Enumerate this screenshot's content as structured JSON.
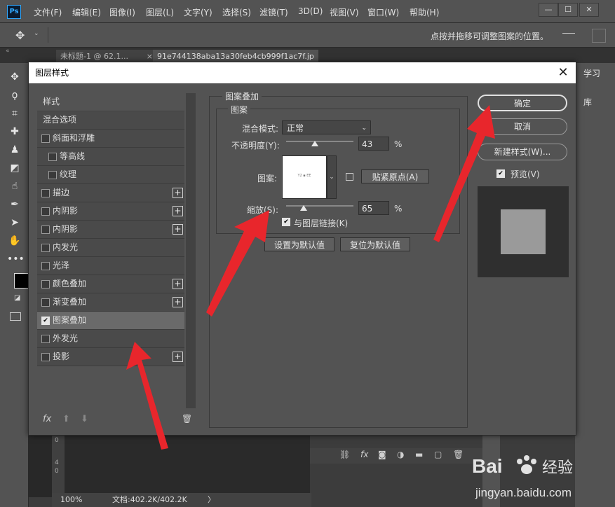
{
  "app": {
    "logo": "Ps",
    "menu": [
      "文件(F)",
      "编辑(E)",
      "图像(I)",
      "图层(L)",
      "文字(Y)",
      "选择(S)",
      "滤镜(T)",
      "3D(D)",
      "视图(V)",
      "窗口(W)",
      "帮助(H)"
    ],
    "window_buttons": [
      "—",
      "☐",
      "✕"
    ],
    "options_hint": "点按并拖移可调整图案的位置。",
    "tabs": [
      "未标题-1 @ 62.1...",
      "91e744138aba13a30feb4cb999f1ac7f.jp"
    ],
    "tab_close": "×",
    "right_panel_label": "学习",
    "right_panel_lib": "库",
    "status": {
      "zoom": "100%",
      "doc": "文档:402.2K/402.2K",
      "arrow": "〉"
    },
    "ruler_marks": [
      "0",
      "4",
      "0"
    ]
  },
  "dialog": {
    "title": "图层样式",
    "close": "✕",
    "style_list": {
      "header": "样式",
      "blend": "混合选项",
      "items": [
        {
          "label": "斜面和浮雕",
          "checked": false,
          "plus": false,
          "indent": false
        },
        {
          "label": "等高线",
          "checked": false,
          "plus": false,
          "indent": true
        },
        {
          "label": "纹理",
          "checked": false,
          "plus": false,
          "indent": true
        },
        {
          "label": "描边",
          "checked": false,
          "plus": true,
          "indent": false
        },
        {
          "label": "内阴影",
          "checked": false,
          "plus": true,
          "indent": false
        },
        {
          "label": "内阴影",
          "checked": false,
          "plus": true,
          "indent": false
        },
        {
          "label": "内发光",
          "checked": false,
          "plus": false,
          "indent": false
        },
        {
          "label": "光泽",
          "checked": false,
          "plus": false,
          "indent": false
        },
        {
          "label": "颜色叠加",
          "checked": false,
          "plus": true,
          "indent": false
        },
        {
          "label": "渐变叠加",
          "checked": false,
          "plus": true,
          "indent": false
        },
        {
          "label": "图案叠加",
          "checked": true,
          "plus": false,
          "indent": false,
          "selected": true
        },
        {
          "label": "外发光",
          "checked": false,
          "plus": false,
          "indent": false
        },
        {
          "label": "投影",
          "checked": false,
          "plus": true,
          "indent": false
        }
      ],
      "footer": {
        "fx": "fx",
        "up": "⬆",
        "down": "⬇",
        "trash": "🗑"
      }
    },
    "pattern_overlay": {
      "group_title": "图案叠加",
      "sub_title": "图案",
      "blend_mode_label": "混合模式:",
      "blend_mode_value": "正常",
      "opacity_label": "不透明度(Y):",
      "opacity_value": "43",
      "opacity_fraction": 0.43,
      "percent": "%",
      "pattern_label": "图案:",
      "snap_button": "贴紧原点(A)",
      "scale_label": "缩放(S):",
      "scale_value": "65",
      "scale_fraction": 0.26,
      "link_label": "与图层链接(K)",
      "link_checked": true,
      "set_default": "设置为默认值",
      "reset_default": "复位为默认值"
    },
    "buttons": {
      "ok": "确定",
      "cancel": "取消",
      "new_style": "新建样式(W)...",
      "preview_label": "预览(V)",
      "preview_checked": true
    }
  },
  "watermark": {
    "text": "Bai",
    "suffix": "经验",
    "url": "jingyan.baidu.com"
  },
  "colors": {
    "arrow": "#e8262c",
    "accent": "#31a8ff"
  }
}
